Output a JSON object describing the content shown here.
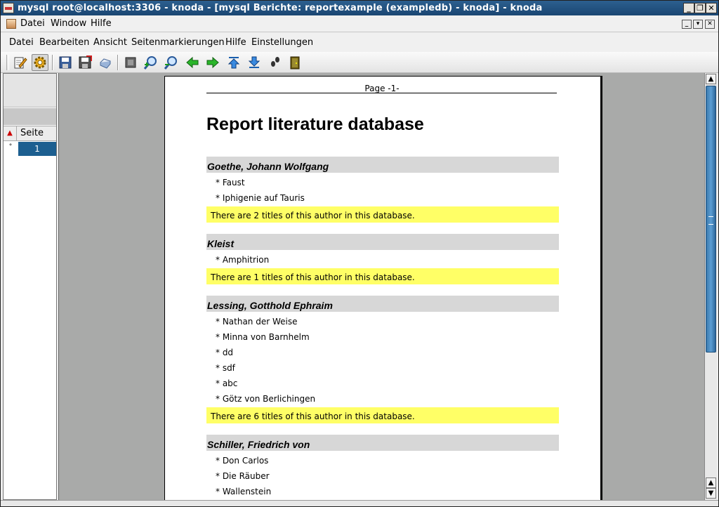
{
  "window": {
    "title": "mysql root@localhost:3306 - knoda - [mysql Berichte: reportexample (exampledb) - knoda] - knoda",
    "controls": [
      "_",
      "❐",
      "✕"
    ]
  },
  "main_menu": [
    "Datei",
    "Window",
    "Hilfe"
  ],
  "mdi_controls": [
    "_",
    "▾",
    "✕"
  ],
  "report_menu": [
    "Datei",
    "Bearbeiten",
    "Ansicht",
    "Seitenmarkierungen",
    "Hilfe",
    "Einstellungen"
  ],
  "toolbar": {
    "icons": [
      "edit-icon",
      "settings-icon",
      "save-icon",
      "save-as-icon",
      "print-icon",
      "fit-page-icon",
      "zoom-in-icon",
      "zoom-out-icon",
      "back-arrow-icon",
      "forward-arrow-icon",
      "first-page-icon",
      "last-page-icon",
      "footsteps-icon",
      "exit-door-icon"
    ]
  },
  "page_list": {
    "header": "Seite",
    "sort_marker": "▲",
    "rows": [
      {
        "marker": "°",
        "value": "1"
      }
    ]
  },
  "report": {
    "page_header": "Page -1-",
    "title": "Report literature database",
    "groups": [
      {
        "author": "Goethe, Johann Wolfgang",
        "titles": [
          "* Faust",
          "* Iphigenie auf Tauris"
        ],
        "summary": "There are 2 titles of this author in this database."
      },
      {
        "author": "Kleist",
        "titles": [
          "* Amphitrion"
        ],
        "summary": "There are 1 titles of this author in this database."
      },
      {
        "author": "Lessing, Gotthold Ephraim",
        "titles": [
          "* Nathan der Weise",
          "* Minna von Barnhelm",
          "* dd",
          "* sdf",
          "* abc",
          "* Götz von Berlichingen"
        ],
        "summary": "There are 6 titles of this author in this database."
      },
      {
        "author": "Schiller, Friedrich von",
        "titles": [
          "* Don Carlos",
          "* Die Räuber",
          "* Wallenstein"
        ],
        "summary": ""
      }
    ]
  },
  "colors": {
    "titlebar": "#1a4672",
    "author_band": "#d7d7d7",
    "summary_band": "#ffff66",
    "selection": "#1d5f90",
    "viewport_bg": "#a9aaa9"
  }
}
